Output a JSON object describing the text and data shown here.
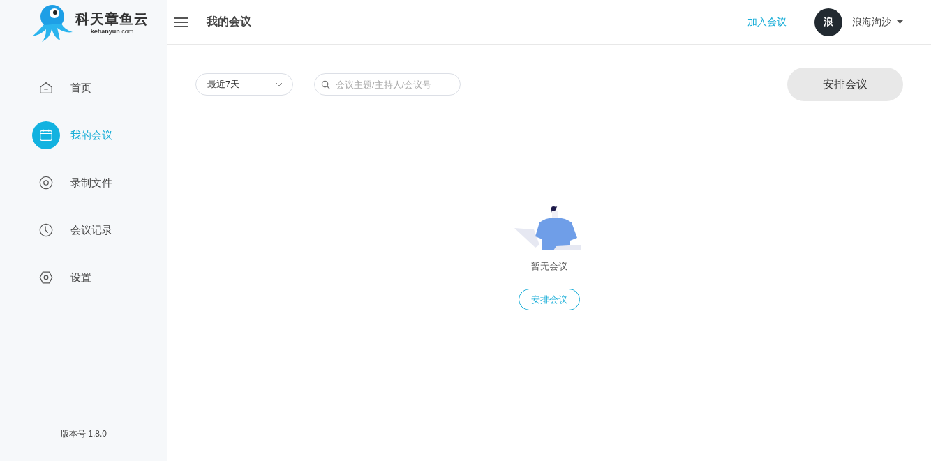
{
  "sidebar": {
    "logo": {
      "name": "科天章鱼云",
      "domain_bold": "ketianyun",
      "domain_rest": ".com"
    },
    "items": [
      {
        "label": "首页",
        "kind": "home",
        "selected": false
      },
      {
        "label": "我的会议",
        "kind": "calendar",
        "selected": true
      },
      {
        "label": "录制文件",
        "kind": "record",
        "selected": false
      },
      {
        "label": "会议记录",
        "kind": "history",
        "selected": false
      },
      {
        "label": "设置",
        "kind": "settings",
        "selected": false
      }
    ],
    "version": "版本号 1.8.0"
  },
  "header": {
    "title": "我的会议",
    "join_link": "加入会议",
    "avatar": "浪",
    "user_name": "浪海淘沙"
  },
  "toolbar": {
    "range": "最近7天",
    "search": {
      "placeholder": "会议主题/主持人/会议号"
    },
    "schedule_button": "安排会议"
  },
  "empty_state": {
    "message": "暂无会议",
    "button": "安排会议"
  }
}
